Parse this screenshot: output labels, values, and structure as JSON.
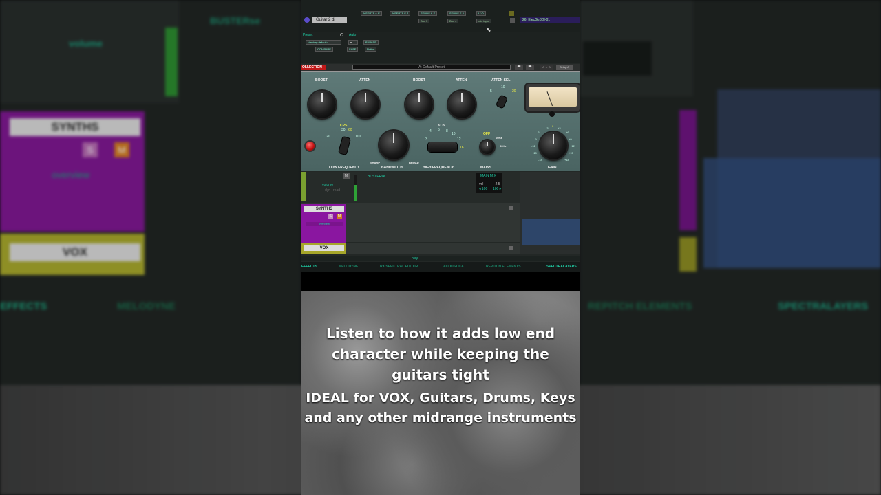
{
  "session": {
    "track_name": "Guitar 2 di",
    "inserts": [
      "INSERTS A-E",
      "INSERTS F-J",
      "SENDS A-E",
      "SENDS F-J",
      "I / O"
    ],
    "insert_slots": [
      "Bus 3",
      "Bus 4",
      "mic input"
    ],
    "clip_name": "26_ElecGtr3DI-01",
    "preset_label": "Preset",
    "auto_label": "Auto",
    "preset_value": "<factory default>",
    "compare": "COMPARE",
    "bypass": "BYPASS",
    "safe": "SAFE",
    "native": "Native",
    "collection": "OLLECTION",
    "preset_name": "A: Default Preset",
    "setup": "Setup A",
    "a_b": "A → B"
  },
  "plugin": {
    "low_boost": "BOOST",
    "low_atten": "ATTEN",
    "high_boost": "BOOST",
    "high_atten": "ATTEN",
    "atten_sel": "ATTEN SEL",
    "cps": "CPS",
    "kcs": "KCS",
    "low_frequency": "LOW FREQUENCY",
    "bandwidth": "BANDWIDTH",
    "high_frequency": "HIGH FREQUENCY",
    "mains": "MAINS",
    "gain": "GAIN",
    "sharp": "SHARP",
    "broad": "BROAD",
    "off": "OFF",
    "hz60": "60Hz",
    "hz50": "50Hz",
    "cps_values": [
      "20",
      "30",
      "60",
      "100"
    ],
    "kcs_values": [
      "3",
      "4",
      "5",
      "8",
      "10",
      "12",
      "16"
    ],
    "atten_sel_values": [
      "5",
      "10",
      "20"
    ],
    "gain_values": [
      "-3",
      "0",
      "+3",
      "-6",
      "+6",
      "-9",
      "+9",
      "-12",
      "+12",
      "-15",
      "+15",
      "-18",
      "+18"
    ]
  },
  "mixer": {
    "volume": "volume",
    "dyn": "dyn",
    "read": "read",
    "bus": "BUSTERse",
    "main_mix": "MAIN MIX",
    "vol_label": "vol",
    "vol_value": "-2.5",
    "pan_left": "◂ 100",
    "pan_right": "100 ▸",
    "synths": "SYNTHS",
    "overview": "overview",
    "vox": "VOX",
    "s": "S",
    "m": "M",
    "play": "play"
  },
  "tabs": [
    "EFFECTS",
    "MELODYNE",
    "RX SPECTRAL EDITOR",
    "ACOUSTICA",
    "REPITCH ELEMENTS",
    "SPECTRALAYERS"
  ],
  "caption": {
    "line1": "Listen to how it adds low end",
    "line2": "character while keeping the",
    "line3": "guitars tight",
    "line4": "IDEAL for VOX, Guitars, Drums, Keys",
    "line5": "and any other midrange instruments"
  },
  "colors": {
    "accent": "#1fd2a8",
    "synths_purple": "#8a16a0",
    "vox_yellow": "#a6a62a",
    "record_red": "#d11a1a"
  }
}
